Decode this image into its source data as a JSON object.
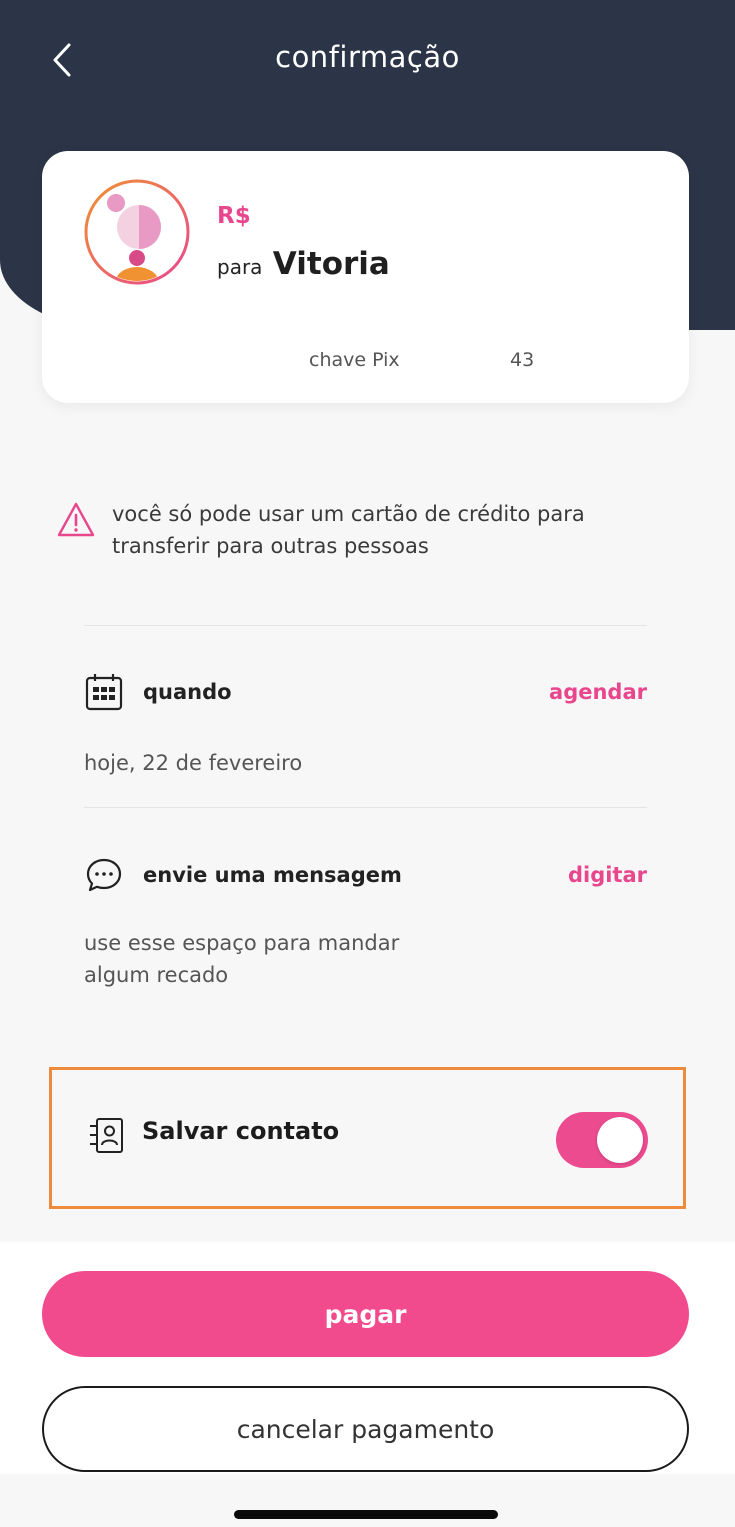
{
  "header": {
    "title": "confirmação",
    "back_icon": "chevron-left-icon"
  },
  "card": {
    "amount_label": "R$",
    "recipient_prefix": "para",
    "recipient_name": "Vitoria",
    "pix_label": "chave Pix",
    "pix_value": "43"
  },
  "warning": {
    "icon": "warning-triangle-icon",
    "text": "você só pode usar um cartão de crédito para transferir para outras pessoas"
  },
  "when": {
    "icon": "calendar-icon",
    "title": "quando",
    "action": "agendar",
    "value": "hoje, 22 de fevereiro"
  },
  "message": {
    "icon": "chat-bubble-icon",
    "title": "envie uma mensagem",
    "action": "digitar",
    "placeholder": "use esse espaço para mandar algum recado"
  },
  "save_contact": {
    "icon": "contact-list-icon",
    "label": "Salvar contato",
    "enabled": true
  },
  "actions": {
    "pay_label": "pagar",
    "cancel_label": "cancelar pagamento"
  },
  "colors": {
    "header_bg": "#2b3547",
    "accent": "#e8478e",
    "highlight_border": "#ef8a3a"
  }
}
